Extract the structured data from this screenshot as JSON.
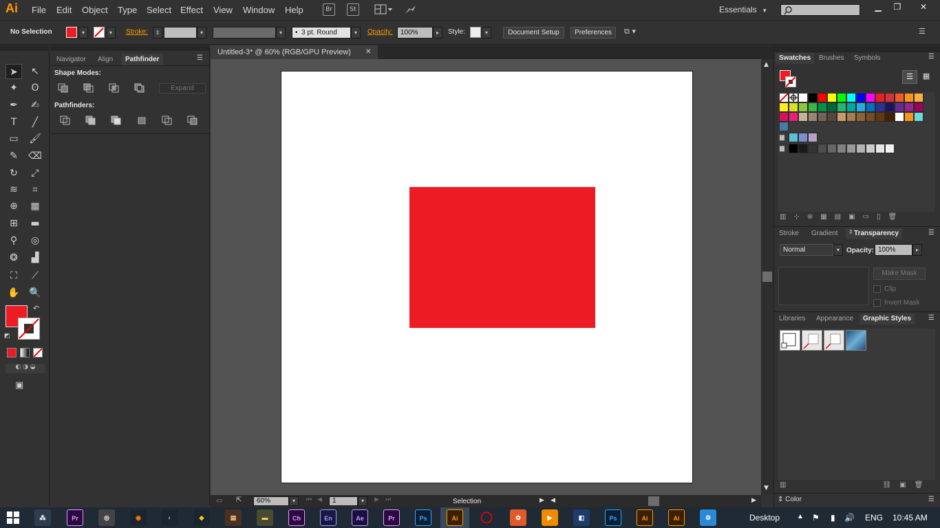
{
  "app": {
    "logo": "Ai"
  },
  "menu": [
    "File",
    "Edit",
    "Object",
    "Type",
    "Select",
    "Effect",
    "View",
    "Window",
    "Help"
  ],
  "menubar_icons": {
    "bridge": "Br",
    "stock": "St"
  },
  "workspace": {
    "label": "Essentials"
  },
  "controlbar": {
    "selection_status": "No Selection",
    "stroke_label": "Stroke:",
    "stroke_profile": "3 pt. Round",
    "opacity_label": "Opacity:",
    "opacity_value": "100%",
    "style_label": "Style:",
    "document_setup": "Document Setup",
    "preferences": "Preferences"
  },
  "pathfinder_panel": {
    "tabs": [
      "Navigator",
      "Align",
      "Pathfinder"
    ],
    "shape_modes_label": "Shape Modes:",
    "expand_button": "Expand",
    "pathfinders_label": "Pathfinders:"
  },
  "document": {
    "tab_title": "Untitled-3* @ 60% (RGB/GPU Preview)",
    "close_symbol": "✕",
    "zoom": "60%",
    "artboard_number": "1",
    "status_tool": "Selection",
    "object_fill": "#ed1c24"
  },
  "swatches_panel": {
    "tabs": [
      "Swatches",
      "Brushes",
      "Symbols"
    ],
    "colors_row1": [
      "#ffffff",
      "#000000",
      "#ff0000",
      "#ffff00",
      "#00ff00",
      "#00ffff",
      "#0000ff",
      "#ff00ff",
      "#ec1c24",
      "#d3343b",
      "#f15a24",
      "#f7941d",
      "#fbb040"
    ],
    "colors_row2": [
      "#fcee21",
      "#d9e021",
      "#8cc63f",
      "#39b54a",
      "#009245",
      "#006837",
      "#22b573",
      "#00a99d",
      "#29abe2",
      "#0071bc",
      "#2e3192",
      "#1b1464",
      "#662d91",
      "#93278f",
      "#9e005d"
    ],
    "colors_row3": [
      "#d4145a",
      "#ed1e79",
      "#c7b299",
      "#998675",
      "#736357",
      "#534741",
      "#c69c6d",
      "#a67c52",
      "#8c6239",
      "#754c24",
      "#603813",
      "#42210b",
      "#ffffff",
      "#f7931e",
      "#6cd9d9"
    ],
    "group1": [
      "#5bc0d3",
      "#7e8ec9",
      "#b89fc9"
    ],
    "group2": [
      "#000000",
      "#1a1a1a",
      "#333333",
      "#4d4d4d",
      "#666666",
      "#808080",
      "#999999",
      "#b3b3b3",
      "#cccccc",
      "#e6e6e6",
      "#f2f2f2"
    ]
  },
  "transparency_panel": {
    "tabs": [
      "Stroke",
      "Gradient",
      "Transparency"
    ],
    "blend_mode": "Normal",
    "opacity_label": "Opacity:",
    "opacity_value": "100%",
    "make_mask": "Make Mask",
    "clip": "Clip",
    "invert_mask": "Invert Mask"
  },
  "graphic_styles_panel": {
    "tabs": [
      "Libraries",
      "Appearance",
      "Graphic Styles"
    ]
  },
  "color_panel": {
    "label": "Color"
  },
  "taskbar": {
    "apps": [
      {
        "label": "Pr",
        "color": "#2a0a40",
        "fg": "#e89bff"
      },
      {
        "label": "Ch",
        "color": "#2a0a40",
        "fg": "#e89bff"
      },
      {
        "label": "En",
        "color": "#1a1840",
        "fg": "#9f9bff"
      },
      {
        "label": "Ae",
        "color": "#1a1040",
        "fg": "#c79bff"
      },
      {
        "label": "Pr",
        "color": "#2a0a40",
        "fg": "#e89bff"
      },
      {
        "label": "Ps",
        "color": "#0a1f35",
        "fg": "#31a8ff"
      },
      {
        "label": "Ai",
        "color": "#3a1f00",
        "fg": "#ff9a00"
      },
      {
        "label": "Ps",
        "color": "#0a1f35",
        "fg": "#31a8ff"
      },
      {
        "label": "Ai",
        "color": "#3a1f00",
        "fg": "#ff9a00"
      },
      {
        "label": "Ai",
        "color": "#3a1f00",
        "fg": "#ff9a00"
      }
    ],
    "desktop_label": "Desktop",
    "language": "ENG",
    "time": "10:45 AM"
  }
}
